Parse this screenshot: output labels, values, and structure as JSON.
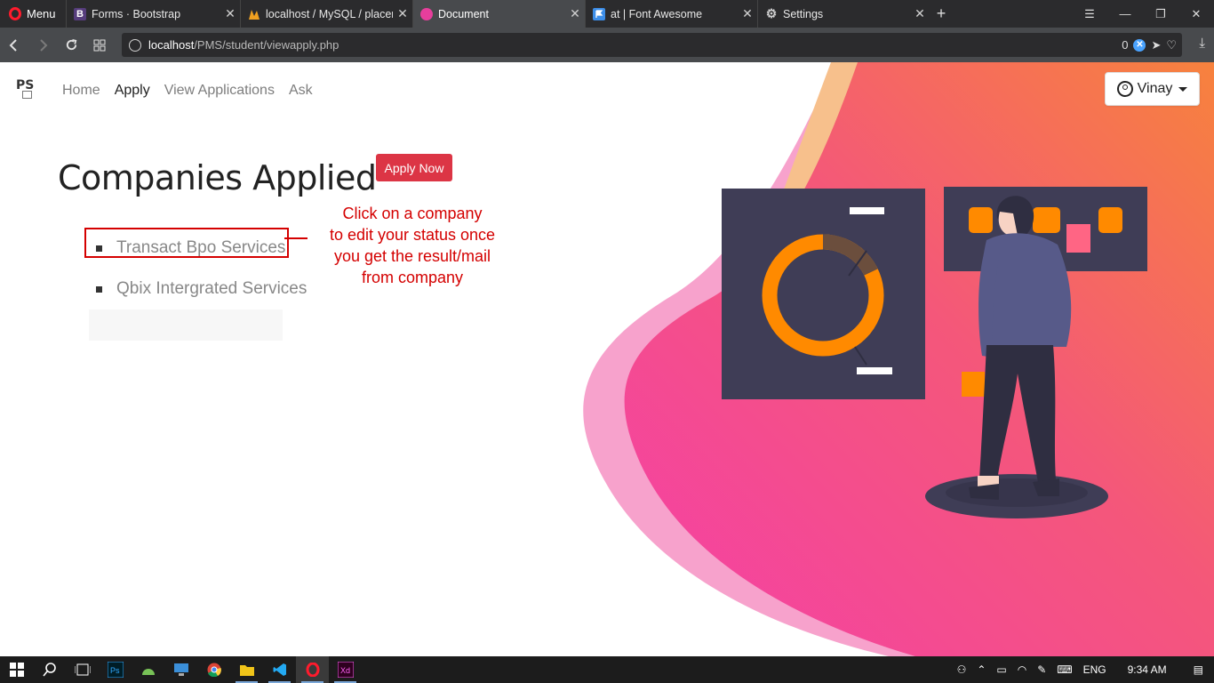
{
  "browser": {
    "menu_label": "Menu",
    "tabs": [
      {
        "label": "Forms · Bootstrap",
        "icon": "bootstrap-icon",
        "icon_text": "B",
        "icon_color": "#563d7c"
      },
      {
        "label": "localhost / MySQL / placement",
        "icon": "phpmyadmin-icon",
        "icon_text": "",
        "icon_color": "#f0a020"
      },
      {
        "label": "Document",
        "icon": "document-icon",
        "icon_text": "",
        "icon_color": "#e73e9c"
      },
      {
        "label": "at | Font Awesome",
        "icon": "flag-icon",
        "icon_text": "",
        "icon_color": "#3d8ee8"
      },
      {
        "label": "Settings",
        "icon": "gear-icon",
        "icon_text": "",
        "icon_color": "#cfcfcf"
      }
    ],
    "url_host": "localhost",
    "url_path": "/PMS/student/viewapply.php",
    "adblock_count": "0"
  },
  "navbar": {
    "brand": "PS",
    "links": [
      {
        "label": "Home",
        "active": false
      },
      {
        "label": "Apply",
        "active": true
      },
      {
        "label": "View Applications",
        "active": false
      },
      {
        "label": "Ask",
        "active": false
      }
    ],
    "user_label": "Vinay"
  },
  "main": {
    "title": "Companies Applied",
    "apply_button": "Apply Now",
    "companies": [
      {
        "name": "Transact Bpo Services",
        "highlighted": true
      },
      {
        "name": "Qbix Intergrated Services",
        "highlighted": false
      }
    ],
    "annotation_lines": [
      "Click on a company",
      "to edit your status once",
      "you get the result/mail",
      "from company"
    ]
  },
  "taskbar": {
    "apps": [
      "windows-start-icon",
      "search-icon",
      "task-view-icon",
      "photoshop-icon",
      "android-studio-icon",
      "remote-desktop-icon",
      "chrome-icon",
      "file-explorer-icon",
      "vscode-icon",
      "opera-icon",
      "adobe-xd-icon"
    ],
    "language": "ENG",
    "time": "9:34 AM"
  },
  "colors": {
    "accent_red": "#dc3545",
    "annotation_red": "#d40000",
    "hero_pink": "#f53fa8",
    "hero_orange": "#f7823d"
  }
}
